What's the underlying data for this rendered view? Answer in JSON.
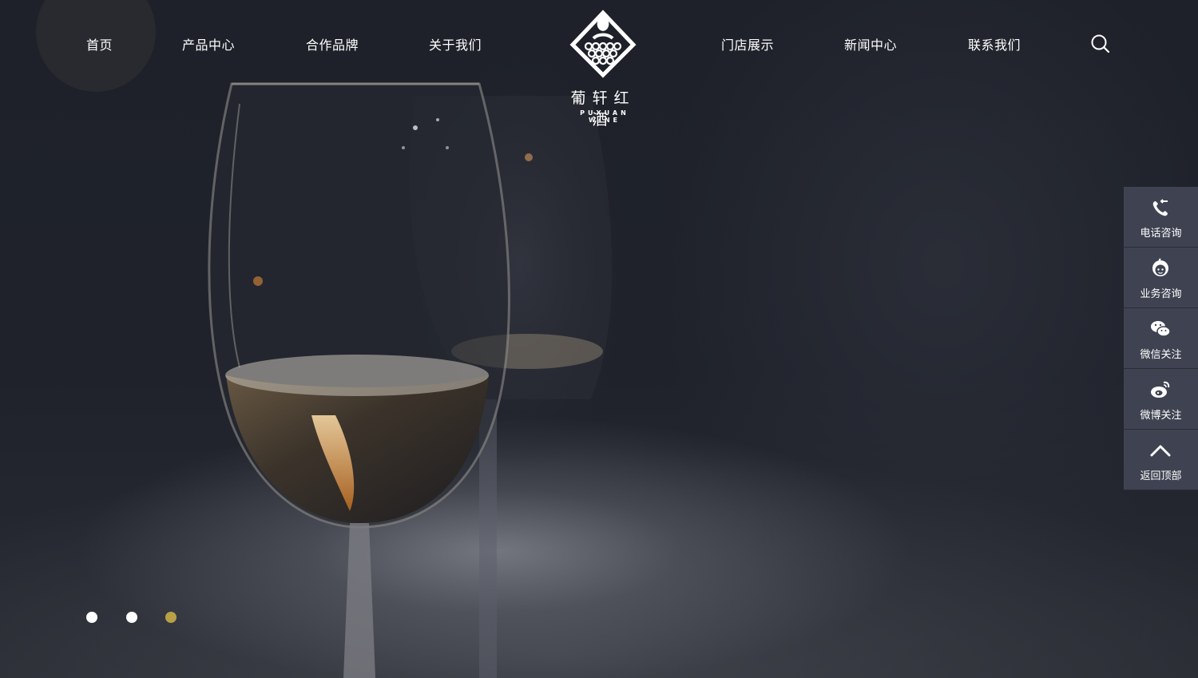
{
  "nav": {
    "left": [
      "首页",
      "产品中心",
      "合作品牌",
      "关于我们"
    ],
    "right": [
      "门店展示",
      "新闻中心",
      "联系我们"
    ]
  },
  "logo": {
    "cn": "葡轩红酒",
    "en": "PUXUAN WINE"
  },
  "search": {
    "icon": "search-icon"
  },
  "sidebar": {
    "items": [
      {
        "label": "电话咨询",
        "icon": "phone-icon"
      },
      {
        "label": "业务咨询",
        "icon": "service-agent-icon"
      },
      {
        "label": "微信关注",
        "icon": "wechat-icon"
      },
      {
        "label": "微博关注",
        "icon": "weibo-icon"
      },
      {
        "label": "返回顶部",
        "icon": "chevron-up-icon"
      }
    ]
  },
  "slider": {
    "count": 3,
    "active_index": 2,
    "active_color": "#b8a046",
    "inactive_color": "#ffffff"
  },
  "colors": {
    "sidebar_bg": "#3f4351",
    "text": "#ffffff"
  }
}
